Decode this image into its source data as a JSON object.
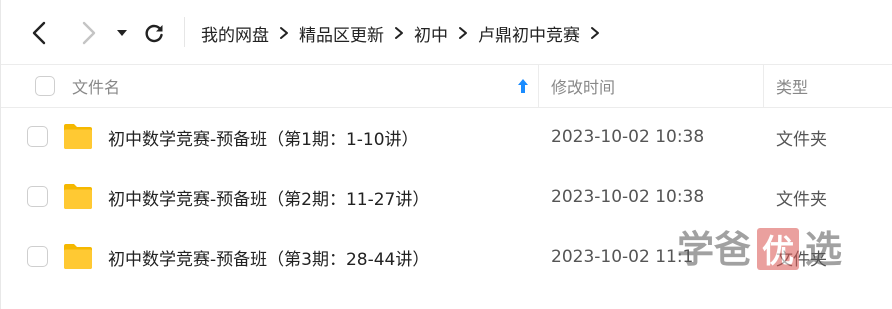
{
  "toolbar": {
    "back_icon": "chevron-left-icon",
    "forward_icon": "chevron-right-icon",
    "dropdown_icon": "caret-down-icon",
    "refresh_icon": "refresh-icon"
  },
  "breadcrumb": {
    "items": [
      "我的网盘",
      "精品区更新",
      "初中",
      "卢鼎初中竞赛"
    ],
    "separator_icon": "chevron-right-icon"
  },
  "table": {
    "headers": {
      "name": "文件名",
      "time": "修改时间",
      "type": "类型"
    },
    "sort_icon": "sort-up-arrow-icon",
    "accent_color": "#1a8cff",
    "folder_color": "#ffc933",
    "rows": [
      {
        "name": "初中数学竞赛-预备班（第1期：1-10讲）",
        "time": "2023-10-02 10:38",
        "type": "文件夹"
      },
      {
        "name": "初中数学竞赛-预备班（第2期：11-27讲）",
        "time": "2023-10-02 10:38",
        "type": "文件夹"
      },
      {
        "name": "初中数学竞赛-预备班（第3期：28-44讲）",
        "time": "2023-10-02 11:1",
        "type": "文件夹"
      }
    ]
  },
  "watermark": {
    "chars": [
      "学",
      "爸",
      "优",
      "选"
    ]
  }
}
